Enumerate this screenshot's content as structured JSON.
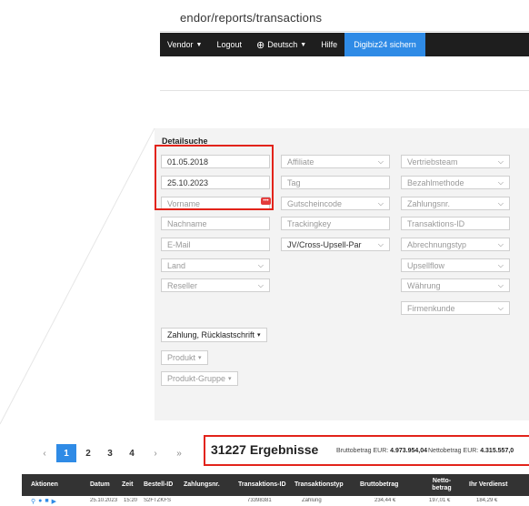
{
  "address_bar": {
    "url": "endor/reports/transactions"
  },
  "navbar": {
    "vendor_label": "Vendor",
    "logout_label": "Logout",
    "language_label": "Deutsch",
    "help_label": "Hilfe",
    "digibiz_button": "Digibiz24 sichern"
  },
  "filter": {
    "title": "Detailsuche",
    "date_from": "01.05.2018",
    "date_to": "25.10.2023",
    "vorname_placeholder": "Vorname",
    "nachname_placeholder": "Nachname",
    "email_placeholder": "E-Mail",
    "land_label": "Land",
    "reseller_label": "Reseller",
    "affiliate_label": "Affiliate",
    "tag_placeholder": "Tag",
    "gutscheincode_label": "Gutscheincode",
    "trackingkey_placeholder": "Trackingkey",
    "jv_label": "JV/Cross-Upsell-Par",
    "vertriebsteam_label": "Vertriebsteam",
    "bezahlmethode_label": "Bezahlmethode",
    "zahlungsnr_label": "Zahlungsnr.",
    "transaktions_id_placeholder": "Transaktions-ID",
    "abrechnungstyp_label": "Abrechnungstyp",
    "upsellflow_label": "Upsellflow",
    "waehrung_label": "Währung",
    "firmenkunde_label": "Firmenkunde",
    "zahlung_button": "Zahlung, Rücklastschrift",
    "produkt_button": "Produkt",
    "produkt_gruppe_button": "Produkt-Gruppe"
  },
  "pagination": {
    "prev": "‹",
    "pages": [
      "1",
      "2",
      "3",
      "4"
    ],
    "next": "›",
    "last": "»"
  },
  "summary": {
    "results": "31227 Ergebnisse",
    "brutto_label": "Bruttobetrag EUR:",
    "brutto_value": "4.973.954,04",
    "netto_label": "Nettobetrag EUR:",
    "netto_value": "4.315.557,0"
  },
  "table": {
    "headers": [
      "Aktionen",
      "Datum",
      "Zeit",
      "Bestell-ID",
      "Zahlungsnr.",
      "Transaktions-ID",
      "Transaktionstyp",
      "Bruttobetrag",
      "Netto-betrag",
      "Ihr Verdienst"
    ],
    "row": [
      "25.10.2023",
      "15:20",
      "S2FTZKFS",
      "73398381",
      "Zahlung",
      "234,44 €",
      "197,01 €",
      "184,29 €"
    ]
  }
}
